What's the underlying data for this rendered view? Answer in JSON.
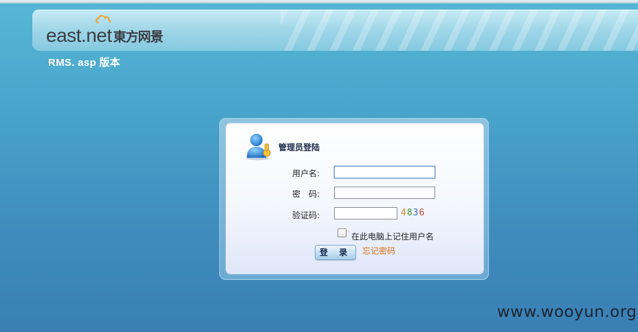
{
  "header": {
    "logo_text": "east.net",
    "logo_cn": "東方网景",
    "version": "RMS. asp 版本"
  },
  "login": {
    "title": "管理员登陆",
    "username_label": "用户名:",
    "username_value": "",
    "password_label": "密　码:",
    "password_value": "",
    "captcha_label": "验证码:",
    "captcha_value": "",
    "captcha_digits": [
      {
        "char": "4",
        "color": "#d38a2a"
      },
      {
        "char": "8",
        "color": "#3a9a3a"
      },
      {
        "char": "3",
        "color": "#2d6fb5"
      },
      {
        "char": "6",
        "color": "#c0402a"
      }
    ],
    "remember_label": "在此电脑上记住用户名",
    "remember_checked": false,
    "login_button": "登 录",
    "forgot_link": "忘记密码"
  },
  "watermark": "www.wooyun.org",
  "icons": {
    "cloud": "cloud-icon",
    "user": "admin-user-icon"
  }
}
